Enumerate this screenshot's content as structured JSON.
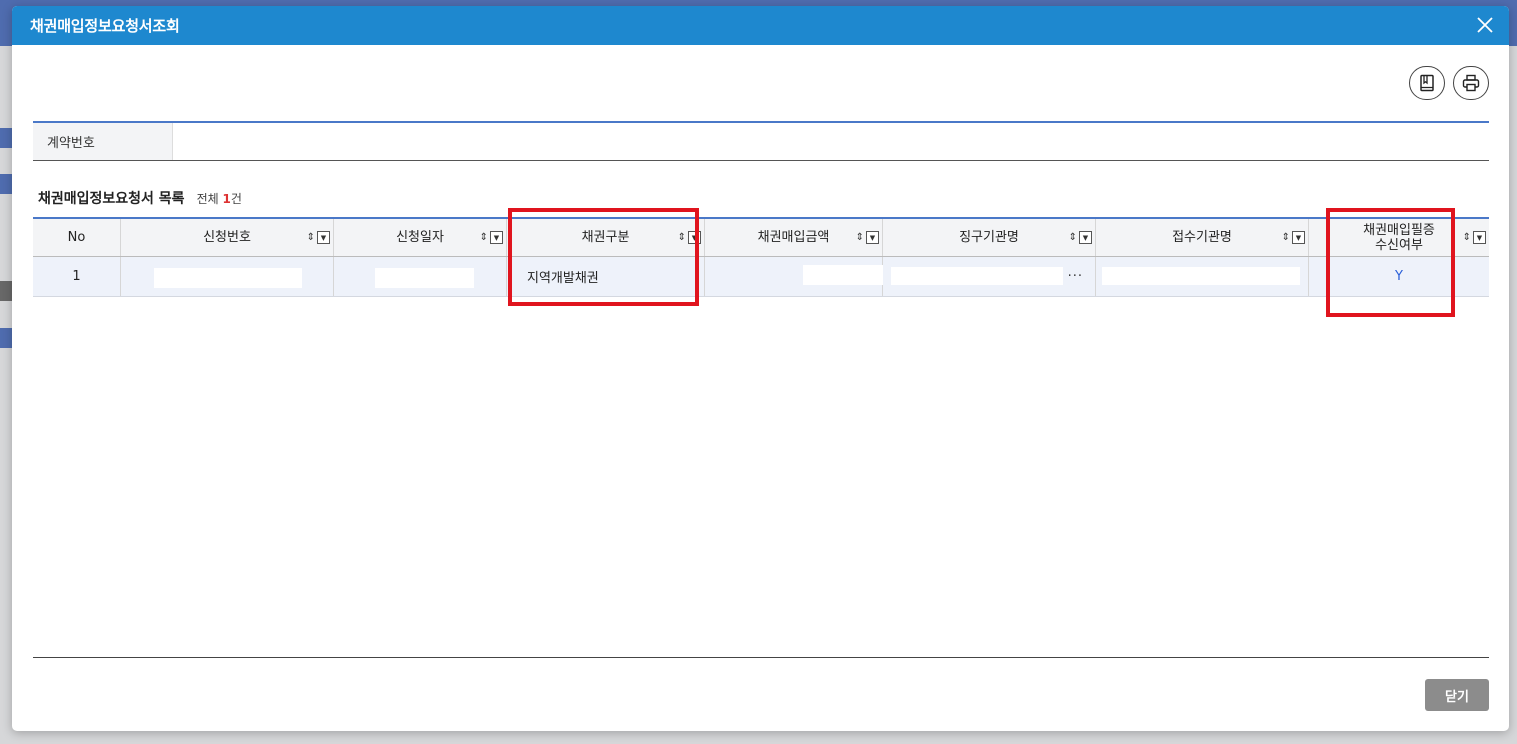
{
  "modal": {
    "title": "채권매입정보요청서조회"
  },
  "search": {
    "contract_label": "계약번호",
    "contract_value": ""
  },
  "list": {
    "title": "채권매입정보요청서 목록",
    "count_prefix": "전체 ",
    "count_value": "1",
    "count_suffix": "건"
  },
  "grid": {
    "columns": [
      {
        "label": "No"
      },
      {
        "label": "신청번호"
      },
      {
        "label": "신청일자"
      },
      {
        "label": "채권구분"
      },
      {
        "label": "채권매입금액"
      },
      {
        "label": "징구기관명"
      },
      {
        "label": "접수기관명"
      },
      {
        "label": "채권매입필증\n수신여부"
      }
    ],
    "rows": [
      {
        "no": "1",
        "request_no": "",
        "request_date": "",
        "bond_type": "지역개발채권",
        "purchase_amount": "",
        "collecting_agency": "",
        "receiving_agency": "",
        "receipt_received": "Y"
      }
    ]
  },
  "footer": {
    "close_label": "닫기"
  },
  "icons": {
    "manual": "book-icon",
    "print": "printer-icon",
    "close": "close-icon"
  },
  "colors": {
    "header": "#1e88cf",
    "accent_line": "#4a78c8",
    "highlight": "#e0141e",
    "yes_text": "#2a5fd8"
  }
}
